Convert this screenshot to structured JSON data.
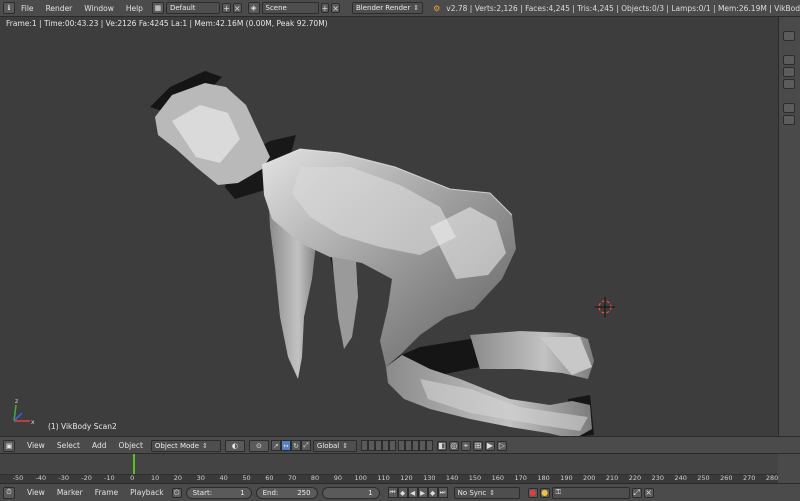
{
  "info_header": {
    "menus": [
      "File",
      "Render",
      "Window",
      "Help"
    ],
    "layout": "Default",
    "scene": "Scene",
    "engine": "Blender Render",
    "stats": "v2.78 | Verts:2,126 | Faces:4,245 | Tris:4,245 | Objects:0/3 | Lamps:0/1 | Mem:26.19M | VikBod"
  },
  "viewport": {
    "header_text": "Frame:1 | Time:00:43.23 | Ve:2126 Fa:4245 La:1 | Mem:42.16M (0.00M, Peak 92.70M)",
    "object_label": "(1) VikBody Scan2",
    "colors": {
      "background": "#3d3d3d",
      "mesh_light": "#d9d9d9",
      "mesh_shadow": "#151515"
    }
  },
  "view3d_header": {
    "menus": [
      "View",
      "Select",
      "Add",
      "Object"
    ],
    "mode": "Object Mode",
    "orientation": "Global"
  },
  "timeline": {
    "ticks": [
      "-50",
      "-40",
      "-30",
      "-20",
      "-10",
      "0",
      "10",
      "20",
      "30",
      "40",
      "50",
      "60",
      "70",
      "80",
      "90",
      "100",
      "110",
      "120",
      "130",
      "140",
      "150",
      "160",
      "170",
      "180",
      "190",
      "200",
      "210",
      "220",
      "230",
      "240",
      "250",
      "260",
      "270",
      "280"
    ],
    "current_frame_color": "#62c01e"
  },
  "timeline_header": {
    "menus": [
      "View",
      "Marker",
      "Frame",
      "Playback"
    ],
    "start_label": "Start:",
    "start_value": "1",
    "end_label": "End:",
    "end_value": "250",
    "current_frame": "1",
    "sync": "No Sync"
  }
}
